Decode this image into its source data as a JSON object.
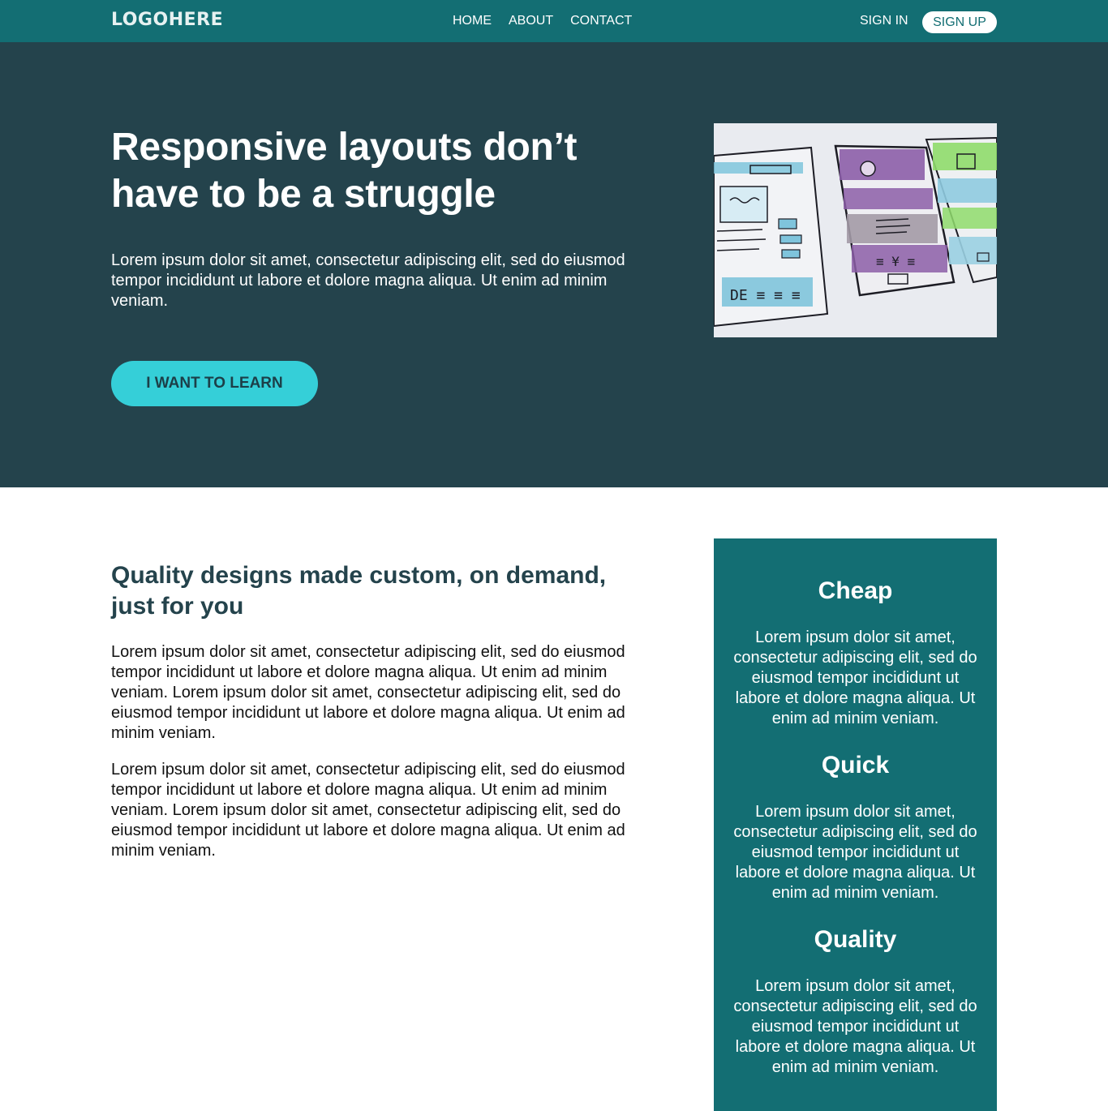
{
  "nav": {
    "logo": "LOGOHERE",
    "links": [
      "HOME",
      "ABOUT",
      "CONTACT"
    ],
    "sign_in": "SIGN IN",
    "sign_up": "SIGN UP"
  },
  "hero": {
    "title": "Responsive layouts don’t have to be a struggle",
    "text": "Lorem ipsum dolor sit amet, consectetur adipiscing elit, sed do eiusmod tempor incididunt ut labore et dolore magna aliqua. Ut enim ad minim veniam.",
    "cta": "I WANT TO LEARN"
  },
  "main": {
    "title": "Quality designs made custom, on demand, just for you",
    "paragraphs": [
      "Lorem ipsum dolor sit amet, consectetur adipiscing elit, sed do eiusmod tempor incididunt ut labore et dolore magna aliqua. Ut enim ad minim veniam. Lorem ipsum dolor sit amet, consectetur adipiscing elit, sed do eiusmod tempor incididunt ut labore et dolore magna aliqua. Ut enim ad minim veniam.",
      "Lorem ipsum dolor sit amet, consectetur adipiscing elit, sed do eiusmod tempor incididunt ut labore et dolore magna aliqua. Ut enim ad minim veniam. Lorem ipsum dolor sit amet, consectetur adipiscing elit, sed do eiusmod tempor incididunt ut labore et dolore magna aliqua. Ut enim ad minim veniam."
    ]
  },
  "features": [
    {
      "title": "Cheap",
      "text": "Lorem ipsum dolor sit amet, consectetur adipiscing elit, sed do eiusmod tempor incididunt ut labore et dolore magna aliqua. Ut enim ad minim veniam."
    },
    {
      "title": "Quick",
      "text": "Lorem ipsum dolor sit amet, consectetur adipiscing elit, sed do eiusmod tempor incididunt ut labore et dolore magna aliqua. Ut enim ad minim veniam."
    },
    {
      "title": "Quality",
      "text": "Lorem ipsum dolor sit amet, consectetur adipiscing elit, sed do eiusmod tempor incididunt ut labore et dolore magna aliqua. Ut enim ad minim veniam."
    }
  ],
  "colors": {
    "nav_bg": "#136e73",
    "hero_bg": "#24434c",
    "cta_bg": "#35cfd8",
    "sidebar_bg": "#136e73"
  }
}
